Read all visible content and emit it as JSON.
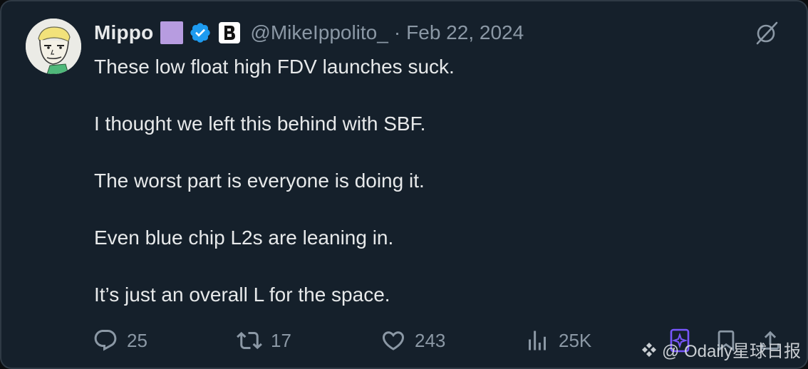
{
  "author": {
    "display_name": "Mippo",
    "handle": "@MikeIppolito_",
    "separator": "·",
    "date": "Feb 22, 2024",
    "avatar_icon": "cartoon-face-avatar",
    "badge_color": "#b79ce0",
    "verified_color": "#1d9bf0"
  },
  "tweet": {
    "paragraphs": [
      "These low float high FDV launches suck.",
      "I thought we left this behind with SBF.",
      "The worst part is everyone is doing it.",
      "Even blue chip L2s are leaning in.",
      "It’s just an overall L for the space."
    ]
  },
  "actions": {
    "replies": "25",
    "reposts": "17",
    "likes": "243",
    "views": "25K"
  },
  "watermark": {
    "text": "@ Odaily星球日报"
  },
  "colors": {
    "background": "#15202b",
    "text": "#e7e9ea",
    "muted": "#8b98a5",
    "accent_purple": "#7856ff"
  }
}
